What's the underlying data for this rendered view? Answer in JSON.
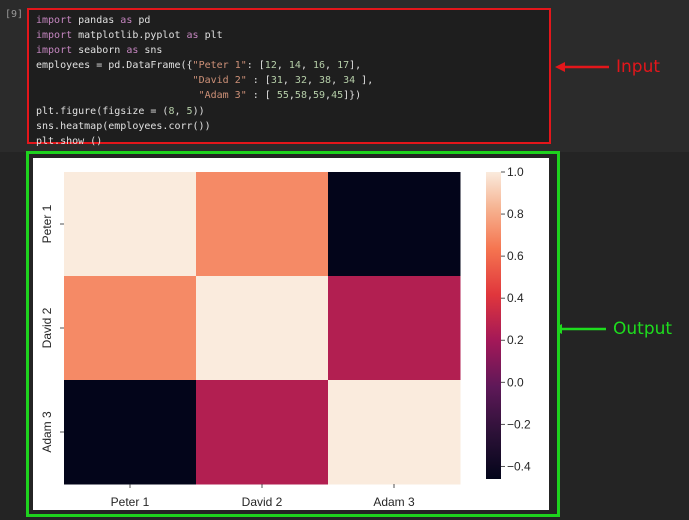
{
  "cell": {
    "prompt": "[9]",
    "code_lines": [
      [
        {
          "t": "import",
          "c": "kw"
        },
        {
          "t": " pandas "
        },
        {
          "t": "as",
          "c": "kw"
        },
        {
          "t": " pd"
        }
      ],
      [
        {
          "t": "import",
          "c": "kw"
        },
        {
          "t": " matplotlib.pyplot "
        },
        {
          "t": "as",
          "c": "kw"
        },
        {
          "t": " plt"
        }
      ],
      [
        {
          "t": "import",
          "c": "kw"
        },
        {
          "t": " seaborn "
        },
        {
          "t": "as",
          "c": "kw"
        },
        {
          "t": " sns"
        }
      ],
      [
        {
          "t": "employees = pd.DataFrame({"
        },
        {
          "t": "\"Peter 1\"",
          "c": "str"
        },
        {
          "t": ": ["
        },
        {
          "t": "12",
          "c": "num"
        },
        {
          "t": ", "
        },
        {
          "t": "14",
          "c": "num"
        },
        {
          "t": ", "
        },
        {
          "t": "16",
          "c": "num"
        },
        {
          "t": ", "
        },
        {
          "t": "17",
          "c": "num"
        },
        {
          "t": "],"
        }
      ],
      [
        {
          "t": "                          "
        },
        {
          "t": "\"David 2\"",
          "c": "str"
        },
        {
          "t": " : ["
        },
        {
          "t": "31",
          "c": "num"
        },
        {
          "t": ", "
        },
        {
          "t": "32",
          "c": "num"
        },
        {
          "t": ", "
        },
        {
          "t": "38",
          "c": "num"
        },
        {
          "t": ", "
        },
        {
          "t": "34",
          "c": "num"
        },
        {
          "t": " ],"
        }
      ],
      [
        {
          "t": "                           "
        },
        {
          "t": "\"Adam 3\"",
          "c": "str"
        },
        {
          "t": " : [ "
        },
        {
          "t": "55",
          "c": "num"
        },
        {
          "t": ","
        },
        {
          "t": "58",
          "c": "num"
        },
        {
          "t": ","
        },
        {
          "t": "59",
          "c": "num"
        },
        {
          "t": ","
        },
        {
          "t": "45",
          "c": "num"
        },
        {
          "t": "]})"
        }
      ],
      [
        {
          "t": "plt.figure(figsize = ("
        },
        {
          "t": "8",
          "c": "num"
        },
        {
          "t": ", "
        },
        {
          "t": "5",
          "c": "num"
        },
        {
          "t": "))"
        }
      ],
      [
        {
          "t": "sns.heatmap(employees.corr())"
        }
      ],
      [
        {
          "t": "plt.show ()"
        }
      ]
    ]
  },
  "annotations": {
    "input_label": "Input",
    "output_label": "Output",
    "input_color": "#e3161b",
    "output_color": "#1edc1e"
  },
  "chart_data": {
    "type": "heatmap",
    "rows": [
      "Peter 1",
      "David 2",
      "Adam 3"
    ],
    "columns": [
      "Peter 1",
      "David 2",
      "Adam 3"
    ],
    "values": [
      [
        1.0,
        0.7,
        -0.46
      ],
      [
        0.7,
        1.0,
        0.25
      ],
      [
        -0.46,
        0.25,
        1.0
      ]
    ],
    "colorbar": {
      "range": [
        -0.46,
        1.0
      ],
      "ticks": [
        1.0,
        0.8,
        0.6,
        0.4,
        0.2,
        0.0,
        -0.2,
        -0.4
      ],
      "tick_labels": [
        "1.0",
        "0.8",
        "0.6",
        "0.4",
        "0.2",
        "0.0",
        "−0.2",
        "−0.4"
      ],
      "colormap": "rocket"
    }
  }
}
